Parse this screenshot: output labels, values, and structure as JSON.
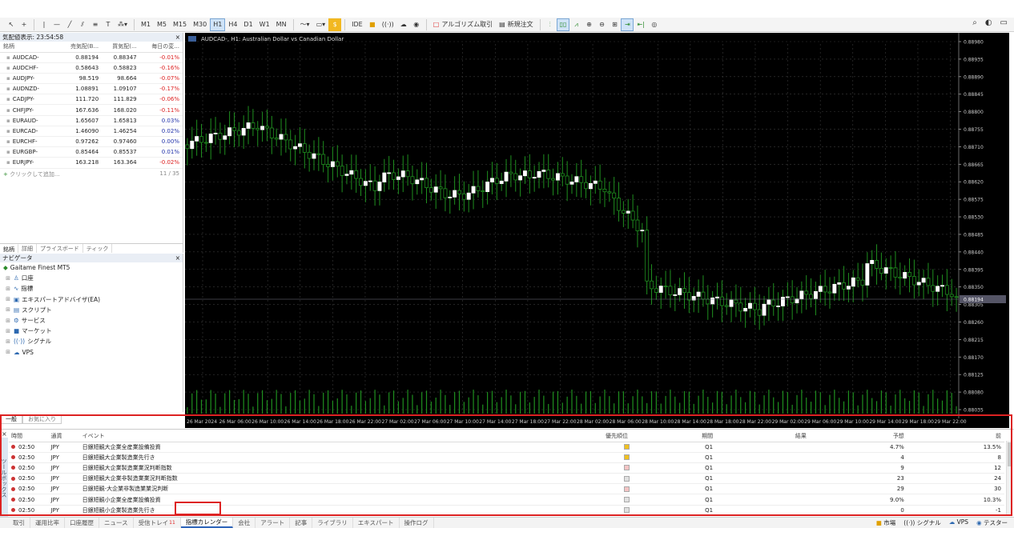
{
  "toolbar": {
    "timeframes": [
      "M1",
      "M5",
      "M15",
      "M30",
      "H1",
      "H4",
      "D1",
      "W1",
      "MN"
    ],
    "active_timeframe": "H1",
    "ide_label": "IDE",
    "algo_label": "アルゴリズム取引",
    "new_order_label": "新規注文"
  },
  "market_watch": {
    "title": "気配値表示: 23:54:58",
    "columns": [
      "銘柄",
      "売気配(B...",
      "買気配(...",
      "毎日の変..."
    ],
    "rows": [
      {
        "symbol": "AUDCAD-",
        "bid": "0.88194",
        "ask": "0.88347",
        "change": "-0.01%",
        "dir": "neg"
      },
      {
        "symbol": "AUDCHF-",
        "bid": "0.58643",
        "ask": "0.58823",
        "change": "-0.16%",
        "dir": "neg"
      },
      {
        "symbol": "AUDJPY-",
        "bid": "98.519",
        "ask": "98.664",
        "change": "-0.07%",
        "dir": "neg"
      },
      {
        "symbol": "AUDNZD-",
        "bid": "1.08891",
        "ask": "1.09107",
        "change": "-0.17%",
        "dir": "neg"
      },
      {
        "symbol": "CADJPY-",
        "bid": "111.720",
        "ask": "111.829",
        "change": "-0.06%",
        "dir": "neg"
      },
      {
        "symbol": "CHFJPY-",
        "bid": "167.636",
        "ask": "168.020",
        "change": "-0.11%",
        "dir": "neg"
      },
      {
        "symbol": "EURAUD-",
        "bid": "1.65607",
        "ask": "1.65813",
        "change": "0.03%",
        "dir": "pos"
      },
      {
        "symbol": "EURCAD-",
        "bid": "1.46090",
        "ask": "1.46254",
        "change": "0.02%",
        "dir": "pos"
      },
      {
        "symbol": "EURCHF-",
        "bid": "0.97262",
        "ask": "0.97460",
        "change": "0.00%",
        "dir": "pos"
      },
      {
        "symbol": "EURGBP-",
        "bid": "0.85464",
        "ask": "0.85537",
        "change": "0.01%",
        "dir": "pos"
      },
      {
        "symbol": "EURJPY-",
        "bid": "163.218",
        "ask": "163.364",
        "change": "-0.02%",
        "dir": "neg"
      }
    ],
    "add_label": "クリックして追加...",
    "count": "11 / 35",
    "tabs": [
      "銘柄",
      "詳細",
      "プライスボード",
      "ティック"
    ]
  },
  "navigator": {
    "title": "ナビゲータ",
    "root": "Gaitame Finest MT5",
    "items": [
      "口座",
      "指標",
      "エキスパートアドバイザ(EA)",
      "スクリプト",
      "サービス",
      "マーケット",
      "シグナル",
      "VPS"
    ]
  },
  "chart": {
    "header": "AUDCAD-, H1: Australian Dollar vs Canadian Dollar",
    "price_labels": [
      "0.88980",
      "0.88935",
      "0.88890",
      "0.88845",
      "0.88800",
      "0.88755",
      "0.88710",
      "0.88665",
      "0.88620",
      "0.88575",
      "0.88530",
      "0.88485",
      "0.88440",
      "0.88395",
      "0.88350",
      "0.88305",
      "0.88260",
      "0.88215",
      "0.88170",
      "0.88125",
      "0.88080",
      "0.88035"
    ],
    "current_price": "0.88194",
    "time_labels": [
      "26 Mar 2024",
      "26 Mar 06:00",
      "26 Mar 10:00",
      "26 Mar 14:00",
      "26 Mar 18:00",
      "26 Mar 22:00",
      "27 Mar 02:00",
      "27 Mar 06:00",
      "27 Mar 10:00",
      "27 Mar 14:00",
      "27 Mar 18:00",
      "27 Mar 22:00",
      "28 Mar 02:00",
      "28 Mar 06:00",
      "28 Mar 10:00",
      "28 Mar 14:00",
      "28 Mar 18:00",
      "28 Mar 22:00",
      "29 Mar 02:00",
      "29 Mar 06:00",
      "29 Mar 10:00",
      "29 Mar 14:00",
      "29 Mar 18:00",
      "29 Mar 22:00"
    ],
    "colors": {
      "bg": "#000000",
      "bull": "#ffffff",
      "bear": "#1f8f1f",
      "grid": "#3a3a3a",
      "volume": "#1f8f1f"
    }
  },
  "bottom_left_tabs": [
    "一般",
    "お気に入り"
  ],
  "calendar": {
    "toolbox_label": "ツールボックス",
    "columns": [
      "時間",
      "通貨",
      "イベント",
      "優先順位",
      "期間",
      "結果",
      "予想",
      "前"
    ],
    "rows": [
      {
        "time": "02:50",
        "currency": "JPY",
        "event": "日銀短観大企業全産業設備投資",
        "priority": "#f0c020",
        "period": "Q1",
        "result": "",
        "forecast": "4.7%",
        "previous": "13.5%"
      },
      {
        "time": "02:50",
        "currency": "JPY",
        "event": "日銀短観大企業製造業先行き",
        "priority": "#f0c020",
        "period": "Q1",
        "result": "",
        "forecast": "4",
        "previous": "8"
      },
      {
        "time": "02:50",
        "currency": "JPY",
        "event": "日銀短観大企業製造業業況判断指数",
        "priority": "#f4c4c4",
        "period": "Q1",
        "result": "",
        "forecast": "9",
        "previous": "12"
      },
      {
        "time": "02:50",
        "currency": "JPY",
        "event": "日銀短観大企業非製造業業況判断指数",
        "priority": "#e0e0e0",
        "period": "Q1",
        "result": "",
        "forecast": "23",
        "previous": "24"
      },
      {
        "time": "02:50",
        "currency": "JPY",
        "event": "日銀短観-大企業非製造業業況判断",
        "priority": "#f4c4c4",
        "period": "Q1",
        "result": "",
        "forecast": "29",
        "previous": "30"
      },
      {
        "time": "02:50",
        "currency": "JPY",
        "event": "日銀短観小企業全産業設備投資",
        "priority": "#e0e0e0",
        "period": "Q1",
        "result": "",
        "forecast": "9.0%",
        "previous": "10.3%"
      },
      {
        "time": "02:50",
        "currency": "JPY",
        "event": "日銀短観小企業製造業先行き",
        "priority": "#e0e0e0",
        "period": "Q1",
        "result": "",
        "forecast": "0",
        "previous": "-1"
      }
    ]
  },
  "status_tabs": [
    {
      "label": "取引",
      "badge": ""
    },
    {
      "label": "運用比率",
      "badge": ""
    },
    {
      "label": "口座履歴",
      "badge": ""
    },
    {
      "label": "ニュース",
      "badge": ""
    },
    {
      "label": "受信トレイ",
      "badge": "11"
    },
    {
      "label": "指標カレンダー",
      "badge": ""
    },
    {
      "label": "会社",
      "badge": ""
    },
    {
      "label": "アラート",
      "badge": ""
    },
    {
      "label": "記事",
      "badge": ""
    },
    {
      "label": "ライブラリ",
      "badge": ""
    },
    {
      "label": "エキスパート",
      "badge": ""
    },
    {
      "label": "操作ログ",
      "badge": ""
    }
  ],
  "active_status_tab": "指標カレンダー",
  "status_right": [
    "市場",
    "シグナル",
    "VPS",
    "テスター"
  ]
}
